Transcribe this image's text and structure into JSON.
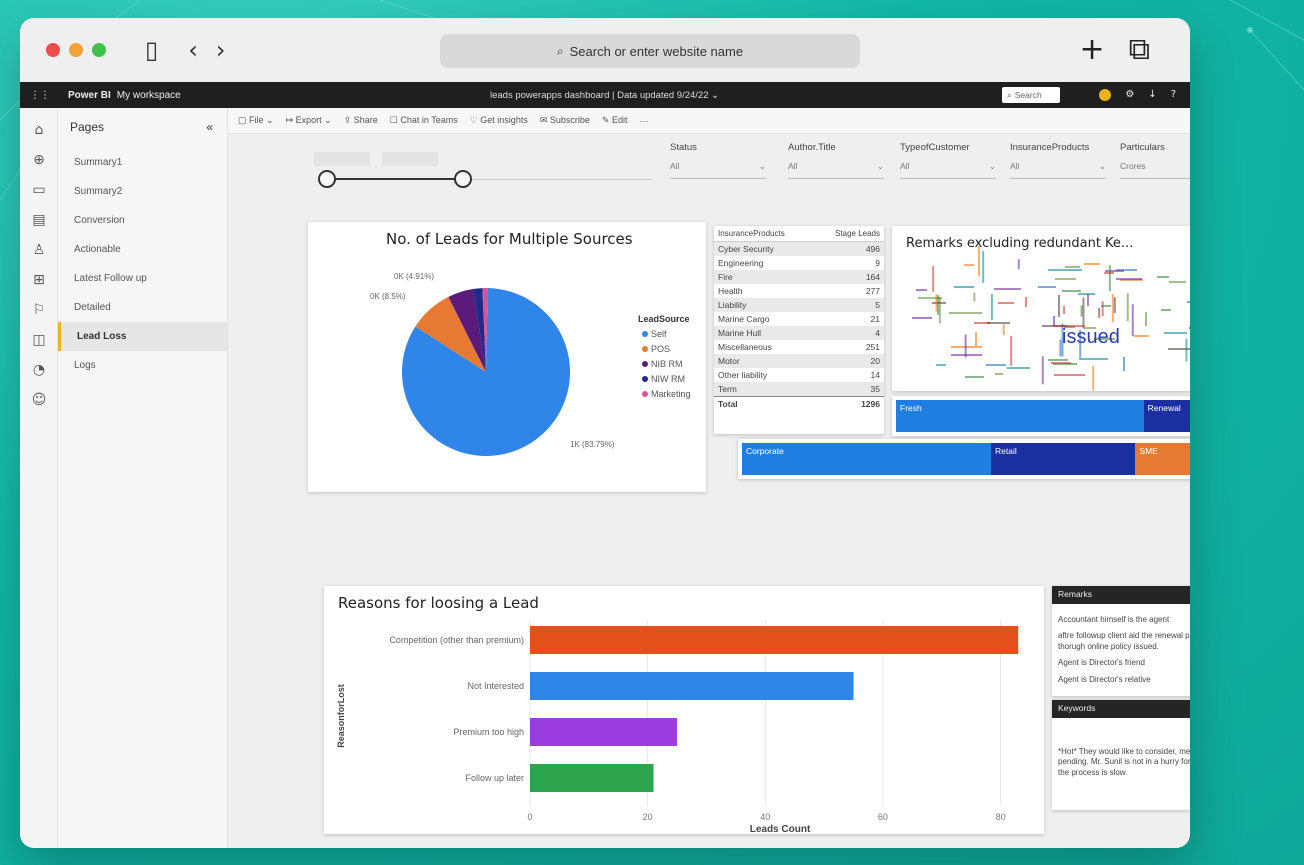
{
  "browser": {
    "address_placeholder": "Search or enter website name"
  },
  "pbi": {
    "brand": "Power BI",
    "workspace": "My workspace",
    "report_title": "leads powerapps dashboard",
    "data_updated": "Data updated 9/24/22",
    "search_placeholder": "Search"
  },
  "pages": {
    "header": "Pages",
    "items": [
      {
        "label": "Summary1"
      },
      {
        "label": "Summary2"
      },
      {
        "label": "Conversion"
      },
      {
        "label": "Actionable"
      },
      {
        "label": "Latest Follow up"
      },
      {
        "label": "Detailed"
      },
      {
        "label": "Lead Loss"
      },
      {
        "label": "Logs"
      }
    ],
    "active_index": 6
  },
  "toolbar": {
    "file": "File",
    "export": "Export",
    "share": "Share",
    "chat": "Chat in Teams",
    "insights": "Get insights",
    "subscribe": "Subscribe",
    "edit": "Edit",
    "more": "···"
  },
  "slicers": [
    {
      "label": "Status",
      "value": "All"
    },
    {
      "label": "Author.Title",
      "value": "All"
    },
    {
      "label": "TypeofCustomer",
      "value": "All"
    },
    {
      "label": "InsuranceProducts",
      "value": "All"
    },
    {
      "label": "Particulars",
      "value": "Crores"
    }
  ],
  "pie_chart": {
    "title": "No. of Leads for Multiple Sources",
    "legend_title": "LeadSource",
    "labels": {
      "self": "1K (83.79%)",
      "pos": "0K (8.5%)",
      "nib": "0K (4.91%)"
    },
    "chart_data": {
      "type": "pie",
      "title": "No. of Leads for Multiple Sources",
      "legend_title": "LeadSource",
      "slices": [
        {
          "name": "Self",
          "percent": 83.79,
          "color": "#2f86e8"
        },
        {
          "name": "POS",
          "percent": 8.5,
          "color": "#e67a32"
        },
        {
          "name": "NIB RM",
          "percent": 4.91,
          "color": "#5a1a7a"
        },
        {
          "name": "NIW RM",
          "percent": 1.8,
          "color": "#1f2a8a"
        },
        {
          "name": "Marketing",
          "percent": 1.0,
          "color": "#d9559b"
        }
      ]
    }
  },
  "stage_table": {
    "headers": [
      "InsuranceProducts",
      "Stage Leads"
    ],
    "rows": [
      {
        "name": "Cyber Security",
        "value": "496"
      },
      {
        "name": "Engineering",
        "value": "9"
      },
      {
        "name": "Fire",
        "value": "164"
      },
      {
        "name": "Health",
        "value": "277"
      },
      {
        "name": "Liability",
        "value": "5"
      },
      {
        "name": "Marine Cargo",
        "value": "21"
      },
      {
        "name": "Marine Hull",
        "value": "4"
      },
      {
        "name": "Miscellaneous",
        "value": "251"
      },
      {
        "name": "Motor",
        "value": "20"
      },
      {
        "name": "Other liability",
        "value": "14"
      },
      {
        "name": "Term",
        "value": "35"
      }
    ],
    "total_label": "Total",
    "total_value": "1296"
  },
  "wordcloud": {
    "title": "Remarks excluding redundant Ke...",
    "big_word": "issued"
  },
  "type_bar": {
    "segments": [
      {
        "label": "Fresh",
        "share": 0.72,
        "color": "#1f7fe0"
      },
      {
        "label": "Renewal",
        "share": 0.28,
        "color": "#1c2fa1"
      }
    ]
  },
  "customer_bar": {
    "segments": [
      {
        "label": "Corporate",
        "share": 0.5,
        "color": "#1f7fe0"
      },
      {
        "label": "Retail",
        "share": 0.29,
        "color": "#1c2fa1"
      },
      {
        "label": "SME",
        "share": 0.21,
        "color": "#e67a32"
      }
    ]
  },
  "loss_chart": {
    "title": "Reasons for loosing a Lead",
    "chart_data": {
      "type": "bar",
      "orientation": "horizontal",
      "title": "Reasons for loosing a Lead",
      "categories": [
        "Competition (other than premium)",
        "Not Interested",
        "Premium too high",
        "Follow up later"
      ],
      "values": [
        83,
        55,
        25,
        21
      ],
      "colors": [
        "#e2501c",
        "#2f86e8",
        "#9a3de0",
        "#2ea44f"
      ],
      "xlabel": "Leads Count",
      "ylabel": "ReasonforLost",
      "xticks": [
        "0",
        "20",
        "40",
        "60",
        "80"
      ],
      "xlim": [
        0,
        85
      ]
    }
  },
  "remarks": {
    "header": "Remarks",
    "lines": [
      "Accountant himself is the agent",
      "aftre followup client aid the renewal premium thorugh online policy issued.",
      "Agent is Director's friend",
      "Agent is Director's relative"
    ]
  },
  "keywords": {
    "header": "Keywords",
    "lines": [
      "*Hot* They would like to consider, meeting is pending. Mr. Sunil is not in a hurry for this hence the process is slow."
    ]
  }
}
